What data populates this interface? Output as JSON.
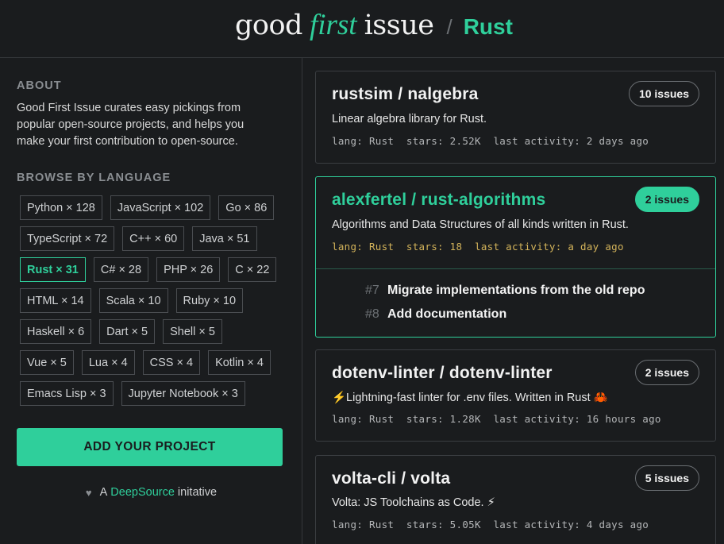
{
  "header": {
    "word1": "good",
    "word2": "first",
    "word3": "issue",
    "separator": "/",
    "language": "Rust"
  },
  "sidebar": {
    "about_label": "ABOUT",
    "about_text": "Good First Issue curates easy pickings from popular open-source projects, and helps you make your first contribution to open-source.",
    "browse_label": "BROWSE BY LANGUAGE",
    "languages": [
      [
        "Python × 128",
        "JavaScript × 102",
        "Go × 86"
      ],
      [
        "TypeScript × 72",
        "C++ × 60",
        "Java × 51"
      ],
      [
        "Rust × 31",
        "C# × 28",
        "PHP × 26",
        "C × 22"
      ],
      [
        "HTML × 14",
        "Scala × 10",
        "Ruby × 10"
      ],
      [
        "Haskell × 6",
        "Dart × 5",
        "Shell × 5"
      ],
      [
        "Vue × 5",
        "Lua × 4",
        "CSS × 4",
        "Kotlin × 4"
      ],
      [
        "Emacs Lisp × 3",
        "Jupyter Notebook × 3"
      ]
    ],
    "active_language": "Rust × 31",
    "add_button": "ADD YOUR PROJECT",
    "credit_prefix": "A",
    "credit_link": "DeepSource",
    "credit_suffix": "initative"
  },
  "repos": [
    {
      "name": "rustsim / nalgebra",
      "issues": "10 issues",
      "description": "Linear algebra library for Rust.",
      "meta": "lang: Rust  stars: 2.52K  last activity: 2 days ago"
    },
    {
      "name": "alexfertel / rust-algorithms",
      "issues": "2 issues",
      "description": "Algorithms and Data Structures of all kinds written in Rust.",
      "meta": "lang: Rust  stars: 18  last activity: a day ago",
      "issue_list": [
        {
          "number": "#7",
          "title": "Migrate implementations from the old repo"
        },
        {
          "number": "#8",
          "title": "Add documentation"
        }
      ]
    },
    {
      "name": "dotenv-linter / dotenv-linter",
      "issues": "2 issues",
      "description": "⚡️Lightning-fast linter for .env files. Written in Rust 🦀",
      "meta": "lang: Rust  stars: 1.28K  last activity: 16 hours ago"
    },
    {
      "name": "volta-cli / volta",
      "issues": "5 issues",
      "description": "Volta: JS Toolchains as Code. ⚡",
      "meta": "lang: Rust  stars: 5.05K  last activity: 4 days ago"
    }
  ]
}
